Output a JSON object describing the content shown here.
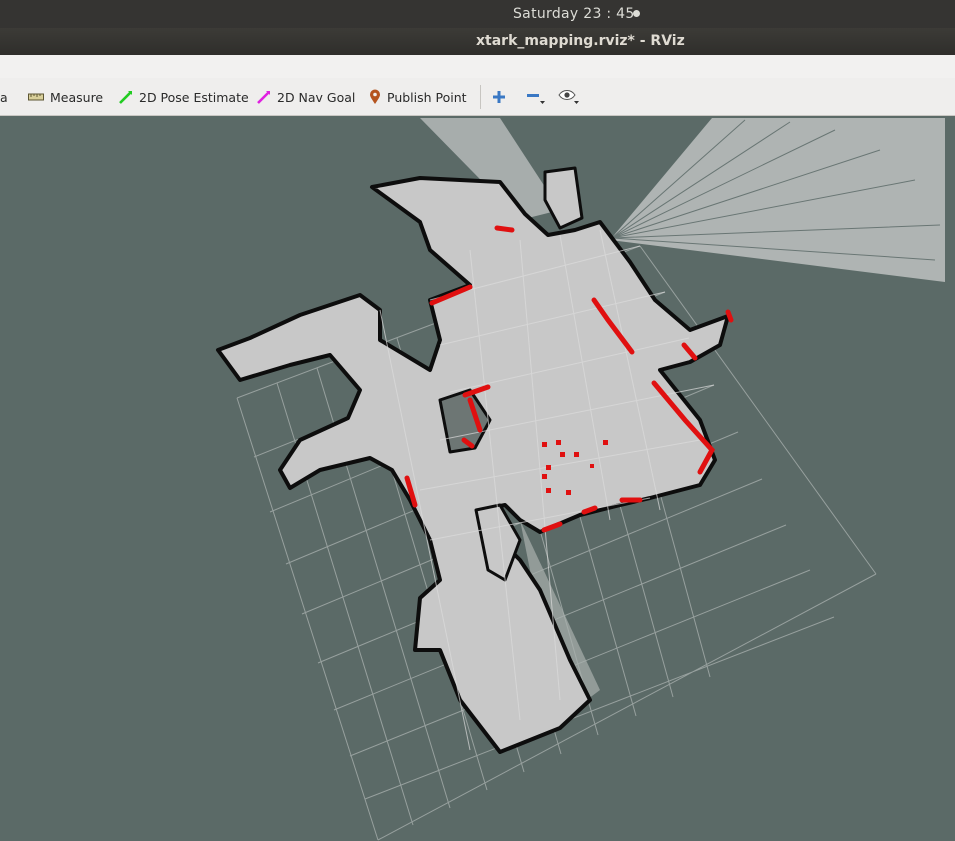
{
  "system": {
    "clock": "Saturday 23 : 45"
  },
  "window": {
    "title": "xtark_mapping.rviz* - RViz"
  },
  "toolbar": {
    "cut_label": "a",
    "measure_label": "Measure",
    "pose_label": "2D Pose Estimate",
    "nav_label": "2D Nav Goal",
    "point_label": "Publish Point"
  },
  "colors": {
    "background": "#5b6a67",
    "free_space": "#c8c8c8",
    "obstacle": "#0d0d0d",
    "laser_scan": "#e01010",
    "grid": "#a2aaa8",
    "pose_arrow": "#22cc22",
    "nav_arrow": "#e020e0",
    "point_pin": "#b5541f"
  },
  "icons": [
    "ruler-icon",
    "green-arrow-icon",
    "magenta-arrow-icon",
    "map-pin-icon",
    "plus-icon",
    "minus-icon",
    "eye-icon"
  ]
}
